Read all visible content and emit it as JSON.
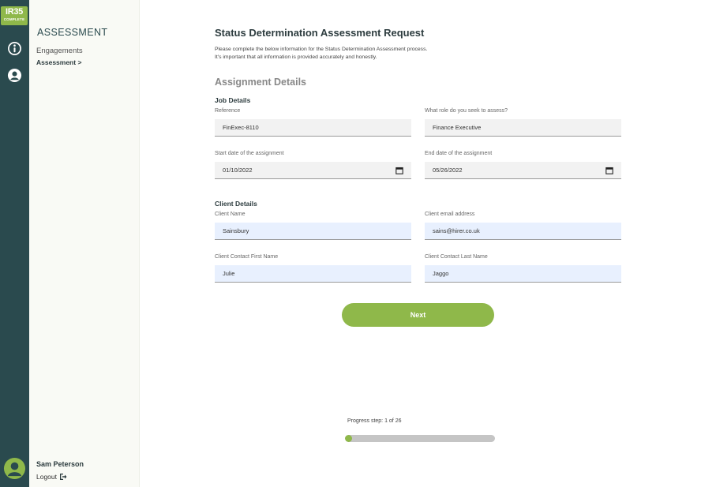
{
  "logo": {
    "line1": "IR35",
    "line2": "COMPLETE"
  },
  "sidebar": {
    "title": "ASSESSMENT",
    "items": [
      {
        "label": "Engagements"
      },
      {
        "label": "Assessment >"
      }
    ]
  },
  "user": {
    "name": "Sam Peterson",
    "logout_label": "Logout"
  },
  "page": {
    "title": "Status Determination Assessment Request",
    "intro_line1": "Please complete the below information for the Status Determination Assessment process.",
    "intro_line2": "It's important that all information is provided accurately and honestly.",
    "section_title": "Assignment Details"
  },
  "job": {
    "heading": "Job Details",
    "reference": {
      "label": "Reference",
      "value": "FinExec-8110"
    },
    "role": {
      "label": "What role do you seek to assess?",
      "value": "Finance Executive"
    },
    "start": {
      "label": "Start date of the assignment",
      "value": "01/10/2022"
    },
    "end": {
      "label": "End date of the assignment",
      "value": "05/26/2022"
    }
  },
  "client": {
    "heading": "Client Details",
    "name": {
      "label": "Client Name",
      "value": "Sainsbury"
    },
    "email": {
      "label": "Client email address",
      "value": "sains@hirer.co.uk"
    },
    "first": {
      "label": "Client Contact First Name",
      "value": "Julie"
    },
    "last": {
      "label": "Client Contact Last Name",
      "value": "Jaggo"
    }
  },
  "next_label": "Next",
  "progress": {
    "label": "Progress step: 1 of 26",
    "fraction": 0.0385
  },
  "colors": {
    "rail": "#2a4a4e",
    "accent": "#8fb84a",
    "autofill": "#e8f0fe"
  },
  "icons": {
    "rail_top": "info-gauge-icon",
    "rail_second": "person-circle-icon",
    "calendar": "calendar-icon",
    "logout": "logout-icon"
  }
}
